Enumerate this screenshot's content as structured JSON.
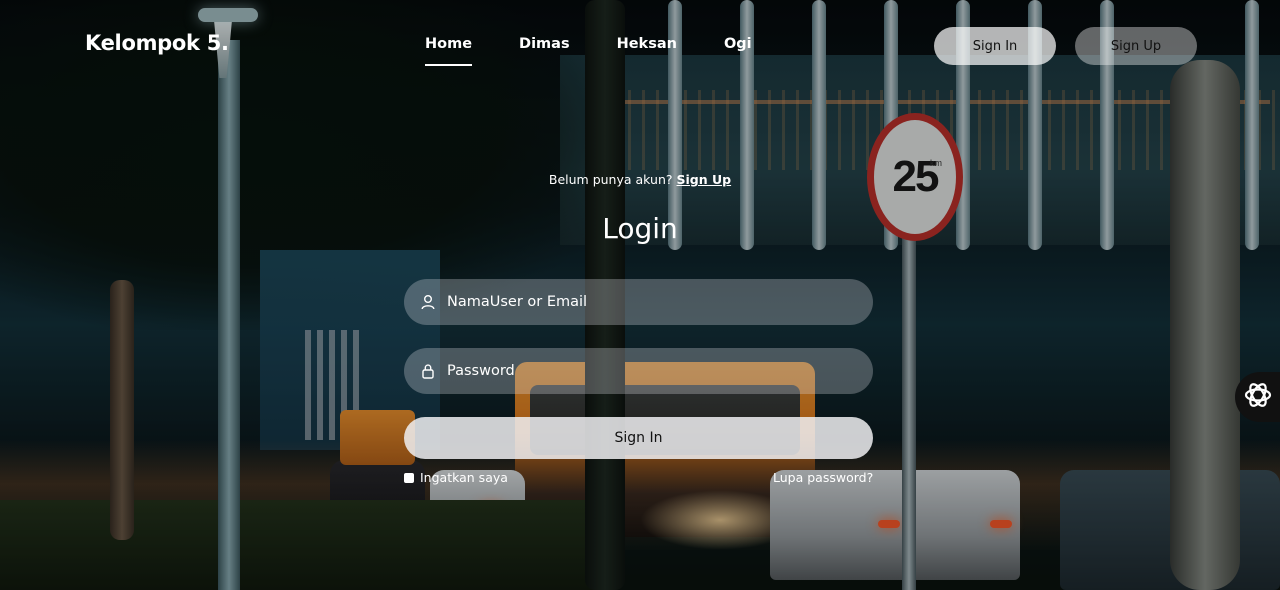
{
  "header": {
    "logo": "Kelompok 5.",
    "nav": [
      {
        "label": "Home",
        "active": true
      },
      {
        "label": "Dimas",
        "active": false
      },
      {
        "label": "Heksan",
        "active": false
      },
      {
        "label": "Ogi",
        "active": false
      }
    ],
    "signin_label": "Sign In",
    "signup_label": "Sign Up"
  },
  "form": {
    "prompt_text": "Belum punya akun?",
    "prompt_link": "Sign Up",
    "title": "Login",
    "username_placeholder": "NamaUser or Email",
    "username_value": "",
    "password_placeholder": "Password",
    "password_value": "",
    "submit_label": "Sign In",
    "remember_label": "Ingatkan saya",
    "forgot_label": "Lupa password?"
  },
  "background": {
    "speed_sign_value": "25",
    "speed_sign_unit": "km"
  },
  "icons": {
    "user": "user-icon",
    "lock": "lock-icon",
    "widget": "openai-logo-icon"
  }
}
